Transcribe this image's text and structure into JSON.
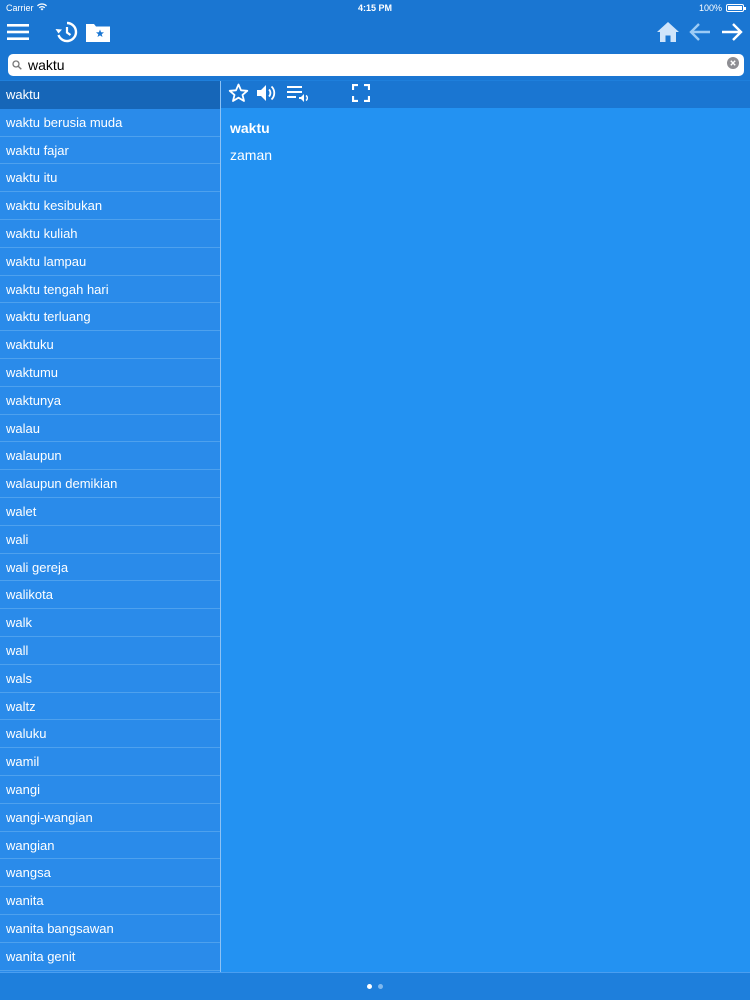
{
  "status": {
    "carrier": "Carrier",
    "time": "4:15 PM",
    "battery": "100%"
  },
  "toolbar": {
    "icons": [
      "menu-icon",
      "history-icon",
      "folder-star-icon",
      "home-icon",
      "arrow-left-icon",
      "arrow-right-icon"
    ]
  },
  "search": {
    "value": "waktu",
    "placeholder": ""
  },
  "list": {
    "selected_index": 0,
    "items": [
      "waktu",
      "waktu berusia muda",
      "waktu fajar",
      "waktu itu",
      "waktu kesibukan",
      "waktu kuliah",
      "waktu lampau",
      "waktu tengah hari",
      "waktu terluang",
      "waktuku",
      "waktumu",
      "waktunya",
      "walau",
      "walaupun",
      "walaupun demikian",
      "walet",
      "wali",
      "wali gereja",
      "walikota",
      "walk",
      "wall",
      "wals",
      "waltz",
      "waluku",
      "wamil",
      "wangi",
      "wangi-wangian",
      "wangian",
      "wangsa",
      "wanita",
      "wanita bangsawan",
      "wanita genit"
    ]
  },
  "detail": {
    "headword": "waktu",
    "definition": "zaman"
  },
  "pager": {
    "pages": 2,
    "current": 1
  },
  "colors": {
    "toolbar": "#1a76d2",
    "list_bg": "#2a8bea",
    "selected": "#1666b8",
    "detail_bg": "#2392f2"
  }
}
